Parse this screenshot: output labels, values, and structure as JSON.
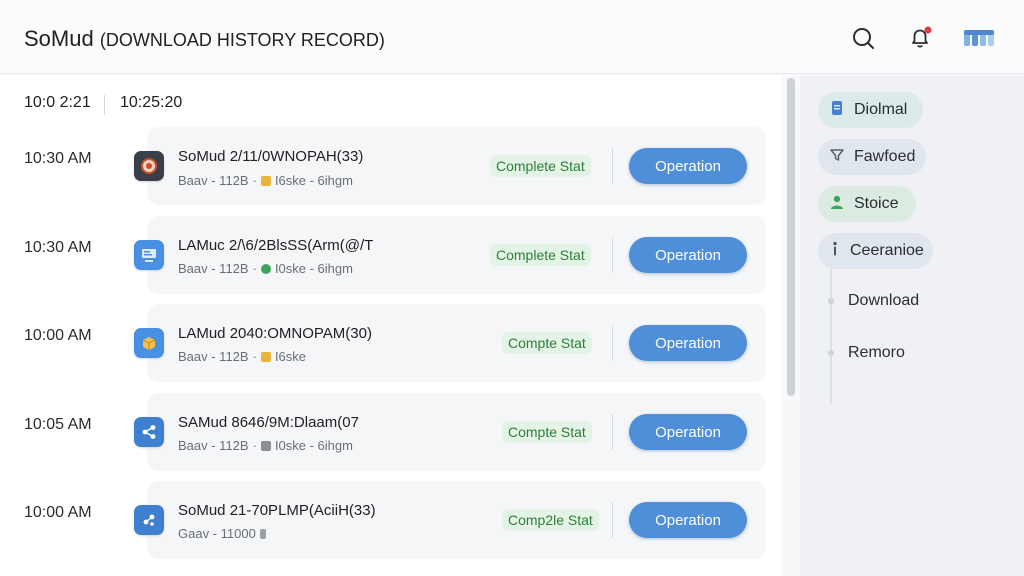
{
  "header": {
    "brand": "SoMud",
    "subtitle": "(DOWNLOAD HISTORY RECORD)",
    "icons": [
      "search-icon",
      "bell-icon",
      "logo-icon"
    ],
    "notification_dot_color": "#e23b3b"
  },
  "list_header": {
    "time_a": "10:0 2:21",
    "time_b": "10:25:20"
  },
  "rows": [
    {
      "time": "10:30 AM",
      "name": "SoMud 2/11/0WNOPAH(33)",
      "meta_a": "Baav - 112B",
      "meta_b": "I6ske - 6ihgm",
      "status": "Complete Stat",
      "action": "Operation",
      "icon": "settings-app-icon"
    },
    {
      "time": "10:30 AM",
      "name": "LAMuc 2/\\6/2BlsSS(Arm(@/T",
      "meta_a": "Baav - 112B",
      "meta_b": "I0ske - 6ihgm",
      "status": "Complete Stat",
      "action": "Operation",
      "icon": "monitor-app-icon"
    },
    {
      "time": "10:00 AM",
      "name": "LAMud 2040:OMNOPAM(30)",
      "meta_a": "Baav - 112B",
      "meta_b": "I6ske",
      "status": "Compte Stat",
      "action": "Operation",
      "icon": "package-app-icon"
    },
    {
      "time": "10:05 AM",
      "name": "SAMud 8646/9M:Dlaam(07",
      "meta_a": "Baav - 112B",
      "meta_b": "I0ske - 6ihgm",
      "status": "Compte Stat",
      "action": "Operation",
      "icon": "share-app-icon"
    },
    {
      "time": "10:00 AM",
      "name": "SoMud 21-70PLMP(AciiH(33)",
      "meta_a": "Gaav - 11000",
      "meta_b": "",
      "status": "Comp2le Stat",
      "action": "Operation",
      "icon": "network-app-icon"
    }
  ],
  "sidebar": {
    "chips": [
      {
        "label": "Diolmal",
        "icon": "document-icon"
      },
      {
        "label": "Fawfoed",
        "icon": "filter-icon"
      },
      {
        "label": "Stoice",
        "icon": "users-icon"
      },
      {
        "label": "Ceeranioe",
        "icon": "info-icon"
      }
    ],
    "tree": [
      {
        "label": "Download"
      },
      {
        "label": "Remoro"
      }
    ]
  },
  "colors": {
    "accent": "#4f8fda",
    "status_bg": "#e3f4e6",
    "status_text": "#2f7d3c"
  }
}
